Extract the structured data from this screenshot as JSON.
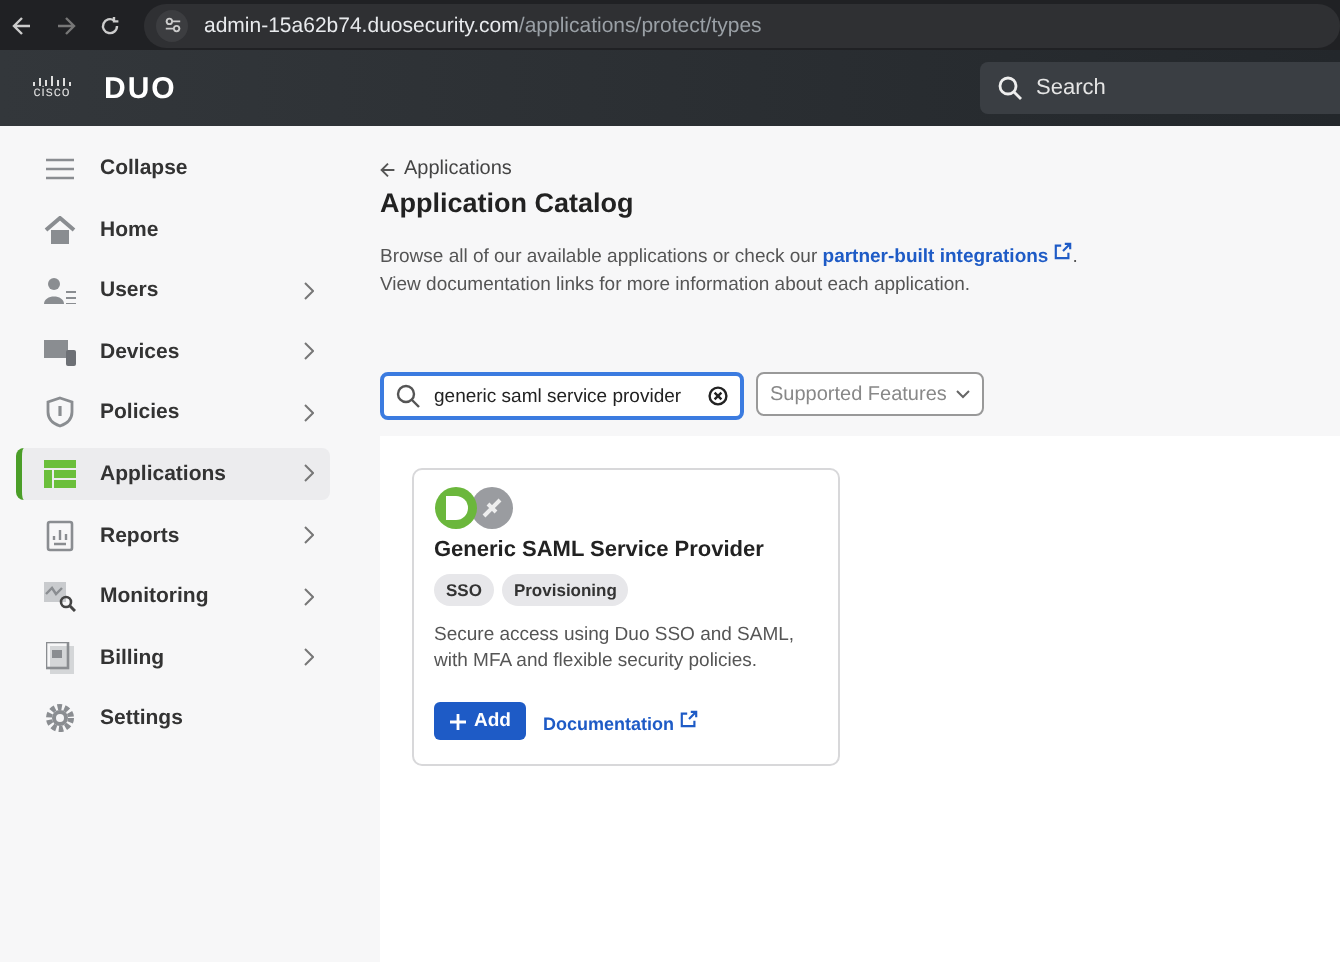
{
  "browser": {
    "url_host": "admin-15a62b74.duosecurity.com",
    "url_path": "/applications/protect/types"
  },
  "header": {
    "cisco_logo": "cisco",
    "duo_logo": "DUO",
    "search": {
      "placeholder": "Search"
    }
  },
  "sidebar": {
    "collapse": "Collapse",
    "items": [
      {
        "label": "Home",
        "has_submenu": false,
        "selected": false
      },
      {
        "label": "Users",
        "has_submenu": true,
        "selected": false
      },
      {
        "label": "Devices",
        "has_submenu": true,
        "selected": false
      },
      {
        "label": "Policies",
        "has_submenu": true,
        "selected": false
      },
      {
        "label": "Applications",
        "has_submenu": true,
        "selected": true
      },
      {
        "label": "Reports",
        "has_submenu": true,
        "selected": false
      },
      {
        "label": "Monitoring",
        "has_submenu": true,
        "selected": false
      },
      {
        "label": "Billing",
        "has_submenu": true,
        "selected": false
      },
      {
        "label": "Settings",
        "has_submenu": false,
        "selected": false
      }
    ]
  },
  "main": {
    "back_link": "Applications",
    "title": "Application Catalog",
    "intro_before": "Browse all of our available applications or check our ",
    "intro_link": "partner-built integrations",
    "intro_after": ".",
    "intro_line2": "View documentation links for more information about each application.",
    "search": {
      "value": "generic saml service provider"
    },
    "filter": {
      "placeholder": "Supported Features"
    },
    "cards": [
      {
        "title": "Generic SAML Service Provider",
        "tags": [
          "SSO",
          "Provisioning"
        ],
        "description": "Secure access using Duo SSO and SAML, with MFA and flexible security policies.",
        "add_button": "Add",
        "doc_link": "Documentation"
      }
    ]
  }
}
